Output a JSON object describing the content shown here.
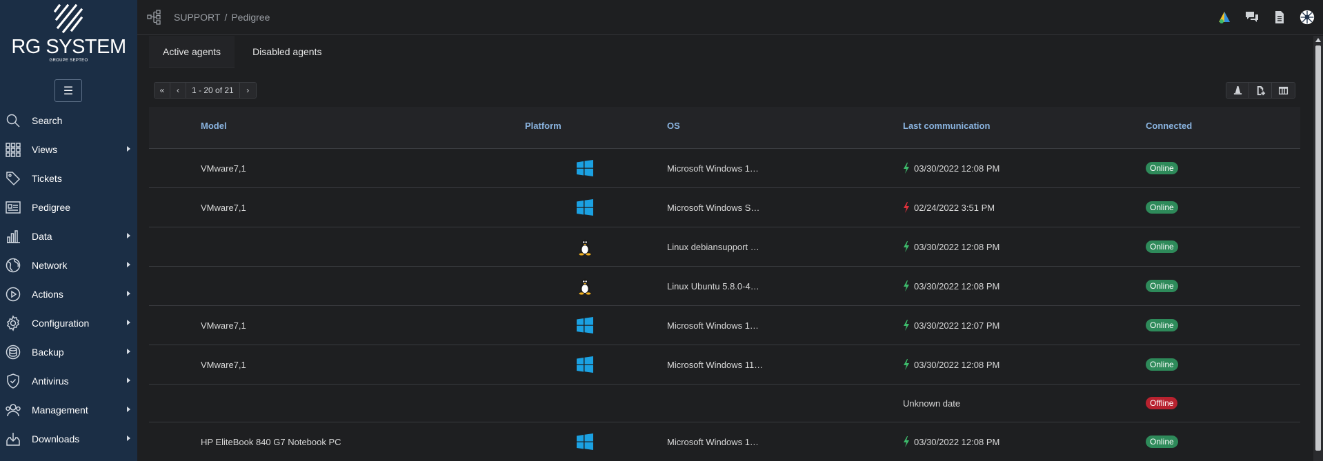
{
  "brand": {
    "name": "RG SYSTEM",
    "tagline": "GROUPE SEPTEO"
  },
  "sidebar": {
    "menu_toggle": "☰",
    "items": [
      {
        "label": "Search",
        "icon": "search-icon",
        "has_submenu": false
      },
      {
        "label": "Views",
        "icon": "grid-icon",
        "has_submenu": true
      },
      {
        "label": "Tickets",
        "icon": "tag-icon",
        "has_submenu": false
      },
      {
        "label": "Pedigree",
        "icon": "id-card-icon",
        "has_submenu": false
      },
      {
        "label": "Data",
        "icon": "bar-chart-icon",
        "has_submenu": true
      },
      {
        "label": "Network",
        "icon": "globe-icon",
        "has_submenu": true
      },
      {
        "label": "Actions",
        "icon": "play-icon",
        "has_submenu": true
      },
      {
        "label": "Configuration",
        "icon": "gear-icon",
        "has_submenu": true
      },
      {
        "label": "Backup",
        "icon": "database-icon",
        "has_submenu": true
      },
      {
        "label": "Antivirus",
        "icon": "shield-icon",
        "has_submenu": true
      },
      {
        "label": "Management",
        "icon": "users-icon",
        "has_submenu": true
      },
      {
        "label": "Downloads",
        "icon": "download-icon",
        "has_submenu": true
      }
    ]
  },
  "breadcrumb": {
    "root": "SUPPORT",
    "separator": "/",
    "current": "Pedigree"
  },
  "tabs": [
    {
      "label": "Active agents",
      "active": true
    },
    {
      "label": "Disabled agents",
      "active": false
    }
  ],
  "pager": {
    "first": "«",
    "prev": "‹",
    "range": "1 - 20 of 21",
    "next": "›"
  },
  "table": {
    "columns": [
      "Model",
      "Platform",
      "OS",
      "Last communication",
      "Connected"
    ],
    "rows": [
      {
        "model": "VMware7,1",
        "platform": "windows",
        "os": "Microsoft Windows 1…",
        "last": "03/30/2022 12:08 PM",
        "bolt": "green",
        "status": "Online"
      },
      {
        "model": "VMware7,1",
        "platform": "windows",
        "os": "Microsoft Windows S…",
        "last": "02/24/2022 3:51 PM",
        "bolt": "red",
        "status": "Online"
      },
      {
        "model": "",
        "platform": "linux",
        "os": "Linux debiansupport …",
        "last": "03/30/2022 12:08 PM",
        "bolt": "green",
        "status": "Online"
      },
      {
        "model": "",
        "platform": "linux",
        "os": "Linux Ubuntu 5.8.0-4…",
        "last": "03/30/2022 12:08 PM",
        "bolt": "green",
        "status": "Online"
      },
      {
        "model": "VMware7,1",
        "platform": "windows",
        "os": "Microsoft Windows 1…",
        "last": "03/30/2022 12:07 PM",
        "bolt": "green",
        "status": "Online"
      },
      {
        "model": "VMware7,1",
        "platform": "windows",
        "os": "Microsoft Windows 11…",
        "last": "03/30/2022 12:08 PM",
        "bolt": "green",
        "status": "Online"
      },
      {
        "model": "",
        "platform": "",
        "os": "",
        "last": "Unknown date",
        "bolt": "",
        "status": "Offline"
      },
      {
        "model": "HP EliteBook 840 G7 Notebook PC",
        "platform": "windows",
        "os": "Microsoft Windows 1…",
        "last": "03/30/2022 12:08 PM",
        "bolt": "green",
        "status": "Online"
      }
    ]
  },
  "colors": {
    "sidebar": "#1b2e45",
    "online": "#2e8a5a",
    "offline": "#b8222f",
    "bolt_green": "#3dbb6b",
    "bolt_red": "#e0303a",
    "header_text": "#8ab4e0",
    "windows_blue": "#1ba1e2"
  }
}
